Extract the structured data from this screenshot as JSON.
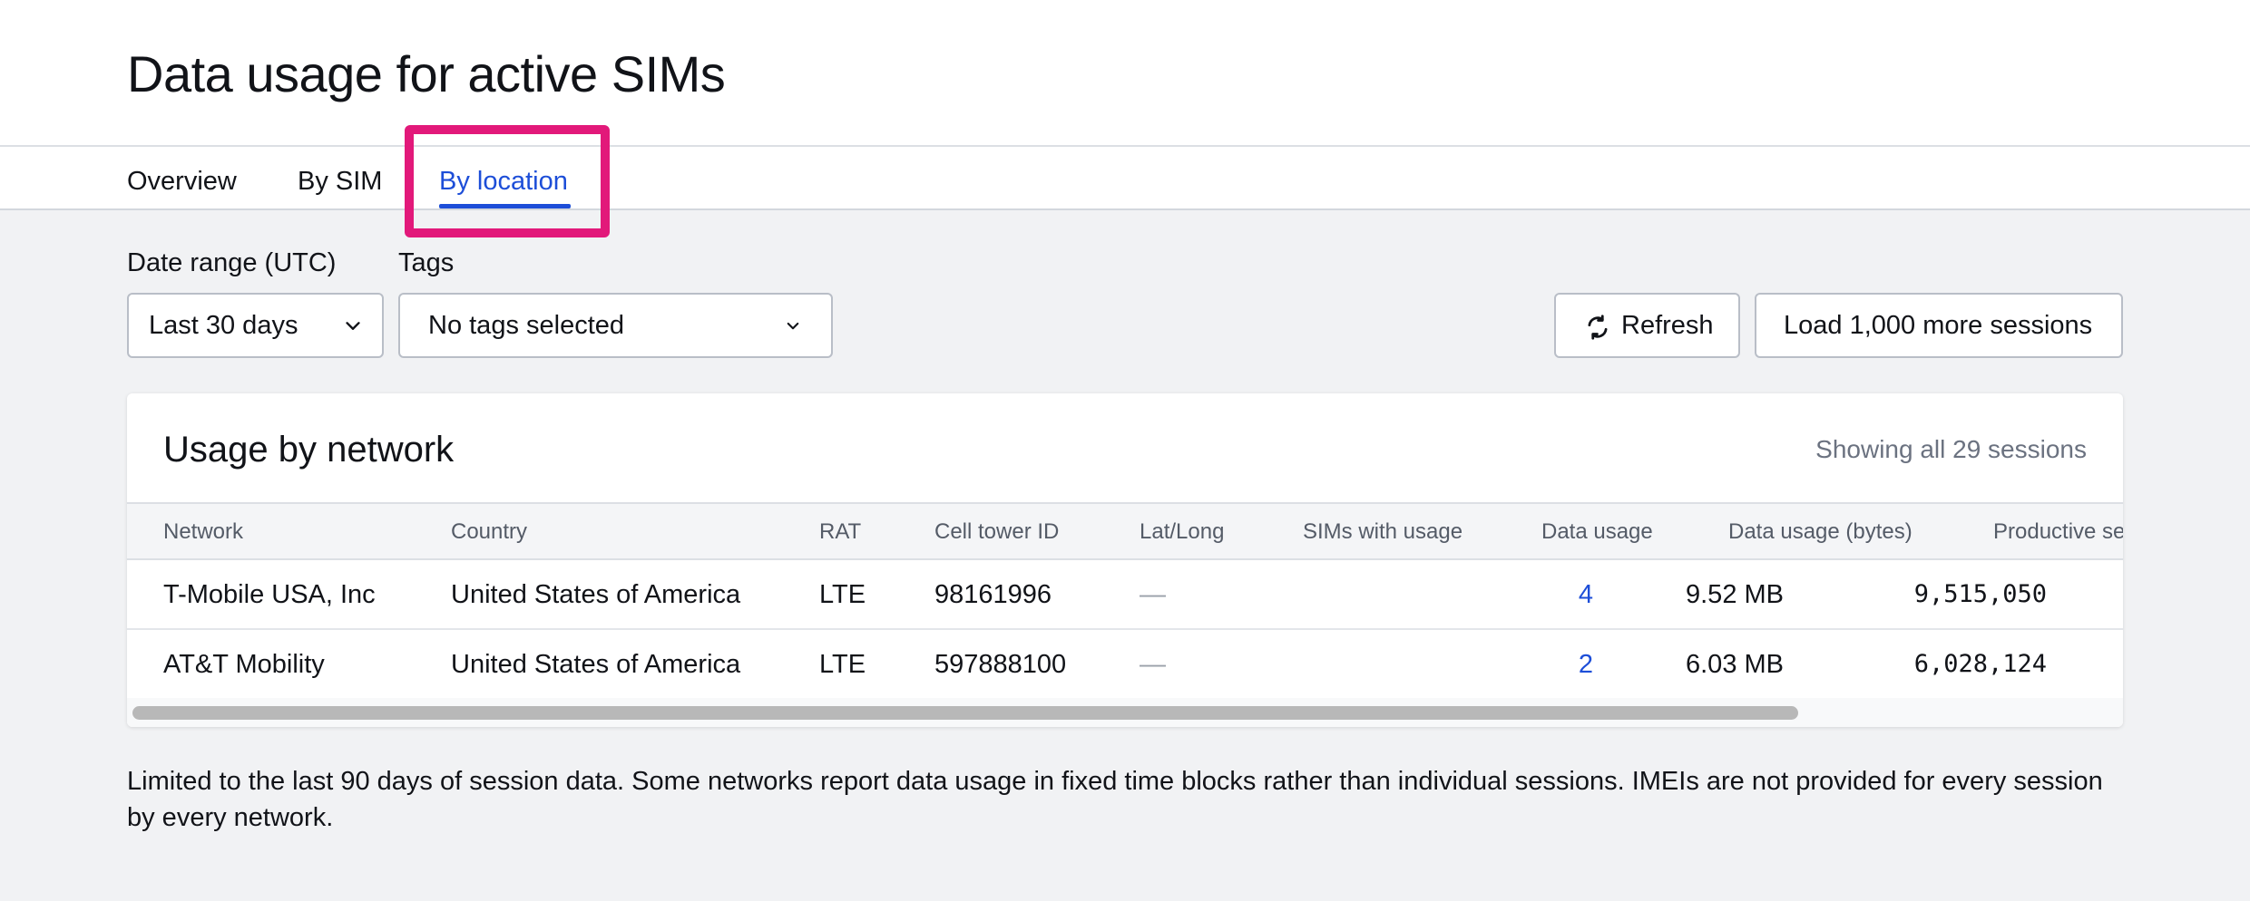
{
  "page": {
    "title": "Data usage for active SIMs"
  },
  "tabs": [
    {
      "label": "Overview",
      "active": false
    },
    {
      "label": "By SIM",
      "active": false
    },
    {
      "label": "By location",
      "active": true
    }
  ],
  "filters": {
    "date_range": {
      "label": "Date range (UTC)",
      "value": "Last 30 days"
    },
    "tags": {
      "label": "Tags",
      "value": "No tags selected"
    }
  },
  "actions": {
    "refresh_label": "Refresh",
    "load_more_label": "Load 1,000 more sessions"
  },
  "card": {
    "title": "Usage by network",
    "meta": "Showing all 29 sessions"
  },
  "table": {
    "columns": [
      "Network",
      "Country",
      "RAT",
      "Cell tower ID",
      "Lat/Long",
      "SIMs with usage",
      "Data usage",
      "Data usage (bytes)",
      "Productive se"
    ],
    "rows": [
      {
        "network": "T-Mobile USA, Inc",
        "country": "United States of America",
        "rat": "LTE",
        "cell_tower_id": "98161996",
        "lat_long": "—",
        "sims_with_usage": "4",
        "data_usage": "9.52 MB",
        "data_usage_bytes": "9,515,050"
      },
      {
        "network": "AT&T Mobility",
        "country": "United States of America",
        "rat": "LTE",
        "cell_tower_id": "597888100",
        "lat_long": "—",
        "sims_with_usage": "2",
        "data_usage": "6.03 MB",
        "data_usage_bytes": "6,028,124"
      }
    ]
  },
  "footnote": "Limited to the last 90 days of session data. Some networks report data usage in fixed time blocks rather than individual sessions. IMEIs are not provided for every session by every network.",
  "colors": {
    "accent": "#1d4ed8",
    "highlight": "#e2197a",
    "page_background": "#f1f2f4"
  },
  "icons": {
    "refresh": "refresh-icon",
    "dropdown": "chevron-down-icon"
  }
}
